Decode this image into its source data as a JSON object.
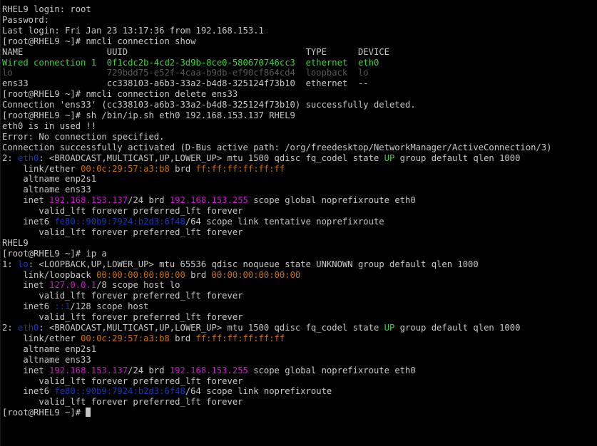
{
  "colors": {
    "default": "#c8c8c8",
    "dim": "#5a5a5a",
    "green": "#38d838",
    "orange": "#c86f10",
    "magenta": "#c818c8",
    "blue": "#1838b8",
    "background": "#000000"
  },
  "terminal": {
    "lines": [
      [
        {
          "t": "RHEL9 login: root"
        }
      ],
      [
        {
          "t": "Password:"
        }
      ],
      [
        {
          "t": "Last login: Fri Jan 23 13:17:36 from 192.168.153.1"
        }
      ],
      [
        {
          "t": "[root@RHEL9 ~]# nmcli connection show"
        }
      ],
      [
        {
          "t": "NAME                UUID                                  TYPE      DEVICE"
        }
      ],
      [
        {
          "t": "Wired connection 1  0f1cdc2b-4cd2-3d9b-8ce0-580670746cc3  ethernet  eth0",
          "c": "green"
        }
      ],
      [
        {
          "t": "lo                  729bdd75-e52f-4caa-b9db-ef90cf864cd4  loopback  lo",
          "c": "dim"
        }
      ],
      [
        {
          "t": "ens33               cc338103-a6b3-33a2-b4d8-325124f73b10  ethernet  --"
        }
      ],
      [
        {
          "t": "[root@RHEL9 ~]# nmcli connection delete ens33"
        }
      ],
      [
        {
          "t": "Connection 'ens33' (cc338103-a6b3-33a2-b4d8-325124f73b10) successfully deleted."
        }
      ],
      [
        {
          "t": "[root@RHEL9 ~]# sh /bin/ip.sh eth0 192.168.153.137 RHEL9"
        }
      ],
      [
        {
          "t": "eth0 is in used !!"
        }
      ],
      [
        {
          "t": "Error: No connection specified."
        }
      ],
      [
        {
          "t": "Connection successfully activated (D-Bus active path: /org/freedesktop/NetworkManager/ActiveConnection/3)"
        }
      ],
      [
        {
          "t": "2: "
        },
        {
          "t": "eth0",
          "c": "blue"
        },
        {
          "t": ": <BROADCAST,MULTICAST,UP,LOWER_UP> mtu 1500 qdisc fq_codel state "
        },
        {
          "t": "UP",
          "c": "green"
        },
        {
          "t": " group default qlen 1000"
        }
      ],
      [
        {
          "t": "    link/ether "
        },
        {
          "t": "00:0c:29:57:a3:b8",
          "c": "orange"
        },
        {
          "t": " brd "
        },
        {
          "t": "ff:ff:ff:ff:ff:ff",
          "c": "orange"
        }
      ],
      [
        {
          "t": "    altname enp2s1"
        }
      ],
      [
        {
          "t": "    altname ens33"
        }
      ],
      [
        {
          "t": "    inet "
        },
        {
          "t": "192.168.153.137",
          "c": "magenta"
        },
        {
          "t": "/24 brd "
        },
        {
          "t": "192.168.153.255",
          "c": "magenta"
        },
        {
          "t": " scope global noprefixroute eth0"
        }
      ],
      [
        {
          "t": "       valid_lft forever preferred_lft forever"
        }
      ],
      [
        {
          "t": "    inet6 "
        },
        {
          "t": "fe80::90b9:7924:b2d3:6f48",
          "c": "blue"
        },
        {
          "t": "/64 scope link tentative noprefixroute"
        }
      ],
      [
        {
          "t": "       valid_lft forever preferred_lft forever"
        }
      ],
      [
        {
          "t": "RHEL9"
        }
      ],
      [
        {
          "t": "[root@RHEL9 ~]# ip a"
        }
      ],
      [
        {
          "t": "1: "
        },
        {
          "t": "lo",
          "c": "blue"
        },
        {
          "t": ": <LOOPBACK,UP,LOWER_UP> mtu 65536 qdisc noqueue state UNKNOWN group default qlen 1000"
        }
      ],
      [
        {
          "t": "    link/loopback "
        },
        {
          "t": "00:00:00:00:00:00",
          "c": "orange"
        },
        {
          "t": " brd "
        },
        {
          "t": "00:00:00:00:00:00",
          "c": "orange"
        }
      ],
      [
        {
          "t": "    inet "
        },
        {
          "t": "127.0.0.1",
          "c": "magenta"
        },
        {
          "t": "/8 scope host lo"
        }
      ],
      [
        {
          "t": "       valid_lft forever preferred_lft forever"
        }
      ],
      [
        {
          "t": "    inet6 "
        },
        {
          "t": "::1",
          "c": "blue"
        },
        {
          "t": "/128 scope host"
        }
      ],
      [
        {
          "t": "       valid_lft forever preferred_lft forever"
        }
      ],
      [
        {
          "t": "2: "
        },
        {
          "t": "eth0",
          "c": "blue"
        },
        {
          "t": ": <BROADCAST,MULTICAST,UP,LOWER_UP> mtu 1500 qdisc fq_codel state "
        },
        {
          "t": "UP",
          "c": "green"
        },
        {
          "t": " group default qlen 1000"
        }
      ],
      [
        {
          "t": "    link/ether "
        },
        {
          "t": "00:0c:29:57:a3:b8",
          "c": "orange"
        },
        {
          "t": " brd "
        },
        {
          "t": "ff:ff:ff:ff:ff:ff",
          "c": "orange"
        }
      ],
      [
        {
          "t": "    altname enp2s1"
        }
      ],
      [
        {
          "t": "    altname ens33"
        }
      ],
      [
        {
          "t": "    inet "
        },
        {
          "t": "192.168.153.137",
          "c": "magenta"
        },
        {
          "t": "/24 brd "
        },
        {
          "t": "192.168.153.255",
          "c": "magenta"
        },
        {
          "t": " scope global noprefixroute eth0"
        }
      ],
      [
        {
          "t": "       valid_lft forever preferred_lft forever"
        }
      ],
      [
        {
          "t": "    inet6 "
        },
        {
          "t": "fe80::90b9:7924:b2d3:6f48",
          "c": "blue"
        },
        {
          "t": "/64 scope link noprefixroute"
        }
      ],
      [
        {
          "t": "       valid_lft forever preferred_lft forever"
        }
      ],
      [
        {
          "t": "[root@RHEL9 ~]# "
        }
      ]
    ]
  }
}
